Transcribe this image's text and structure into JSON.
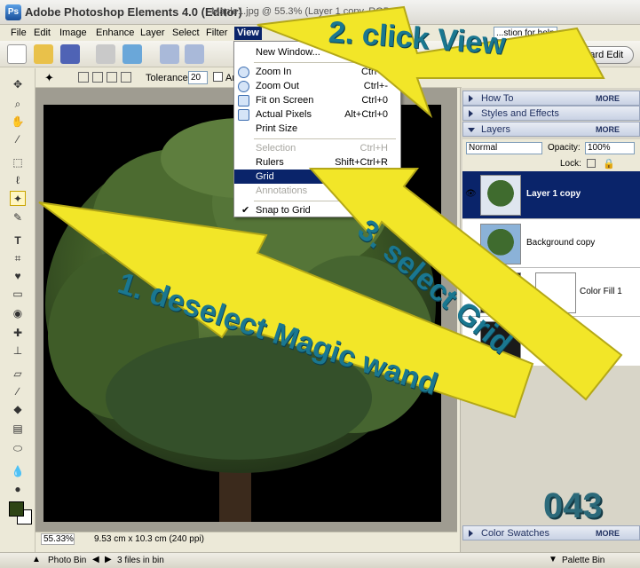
{
  "window": {
    "app_title": "Adobe Photoshop Elements 4.0 (Editor)",
    "doc_title": "Maple1.jpg @ 55.3% (Layer 1 copy, RGB..."
  },
  "menubar": {
    "items": [
      "File",
      "Edit",
      "Image",
      "Enhance",
      "Layer",
      "Select",
      "Filter",
      "View"
    ],
    "active": "View",
    "help_search": "...stion for help"
  },
  "shortcuts": {
    "standard_edit": "...dard Edit"
  },
  "options": {
    "tolerance_label": "Tolerance:",
    "tolerance_value": "20",
    "anti_alias_partial": "An"
  },
  "view_menu": {
    "items": [
      {
        "label": "New Window...",
        "shortcut": ""
      },
      {
        "label": "Zoom In",
        "shortcut": "Ctrl+="
      },
      {
        "label": "Zoom Out",
        "shortcut": "Ctrl+-"
      },
      {
        "label": "Fit on Screen",
        "shortcut": "Ctrl+0"
      },
      {
        "label": "Actual Pixels",
        "shortcut": "Alt+Ctrl+0"
      },
      {
        "label": "Print Size",
        "shortcut": ""
      },
      {
        "label": "Selection",
        "shortcut": "Ctrl+H"
      },
      {
        "label": "Rulers",
        "shortcut": "Shift+Ctrl+R"
      },
      {
        "label": "Grid",
        "shortcut": ""
      },
      {
        "label": "Annotations",
        "shortcut": ""
      },
      {
        "label": "Snap to Grid",
        "shortcut": ""
      }
    ]
  },
  "status": {
    "zoom": "55.33%",
    "doc_size": "9.53 cm x 10.3 cm (240 ppi)"
  },
  "photobin": {
    "label": "Photo Bin",
    "files": "3 files in bin",
    "palette_bin": "Palette Bin"
  },
  "palettes": {
    "how_to": "How To",
    "styles": "Styles and Effects",
    "layers": "Layers",
    "color_swatches": "Color Swatches",
    "more": "MORE"
  },
  "layers": {
    "blend_mode": "Normal",
    "opacity_label": "Opacity:",
    "opacity_value": "100%",
    "lock_label": "Lock:",
    "rows": [
      "Layer 1 copy",
      "Background copy",
      "Color Fill 1"
    ]
  },
  "annotations": {
    "step1": "1. deselect Magic wand",
    "step2": "2. click View",
    "step3": "3. select Grid",
    "frame": "043"
  },
  "colors": {
    "foreground": "#2e4414",
    "background": "#ffffff",
    "arrow": "#f2e628",
    "annotation_text": "#1a7790"
  }
}
